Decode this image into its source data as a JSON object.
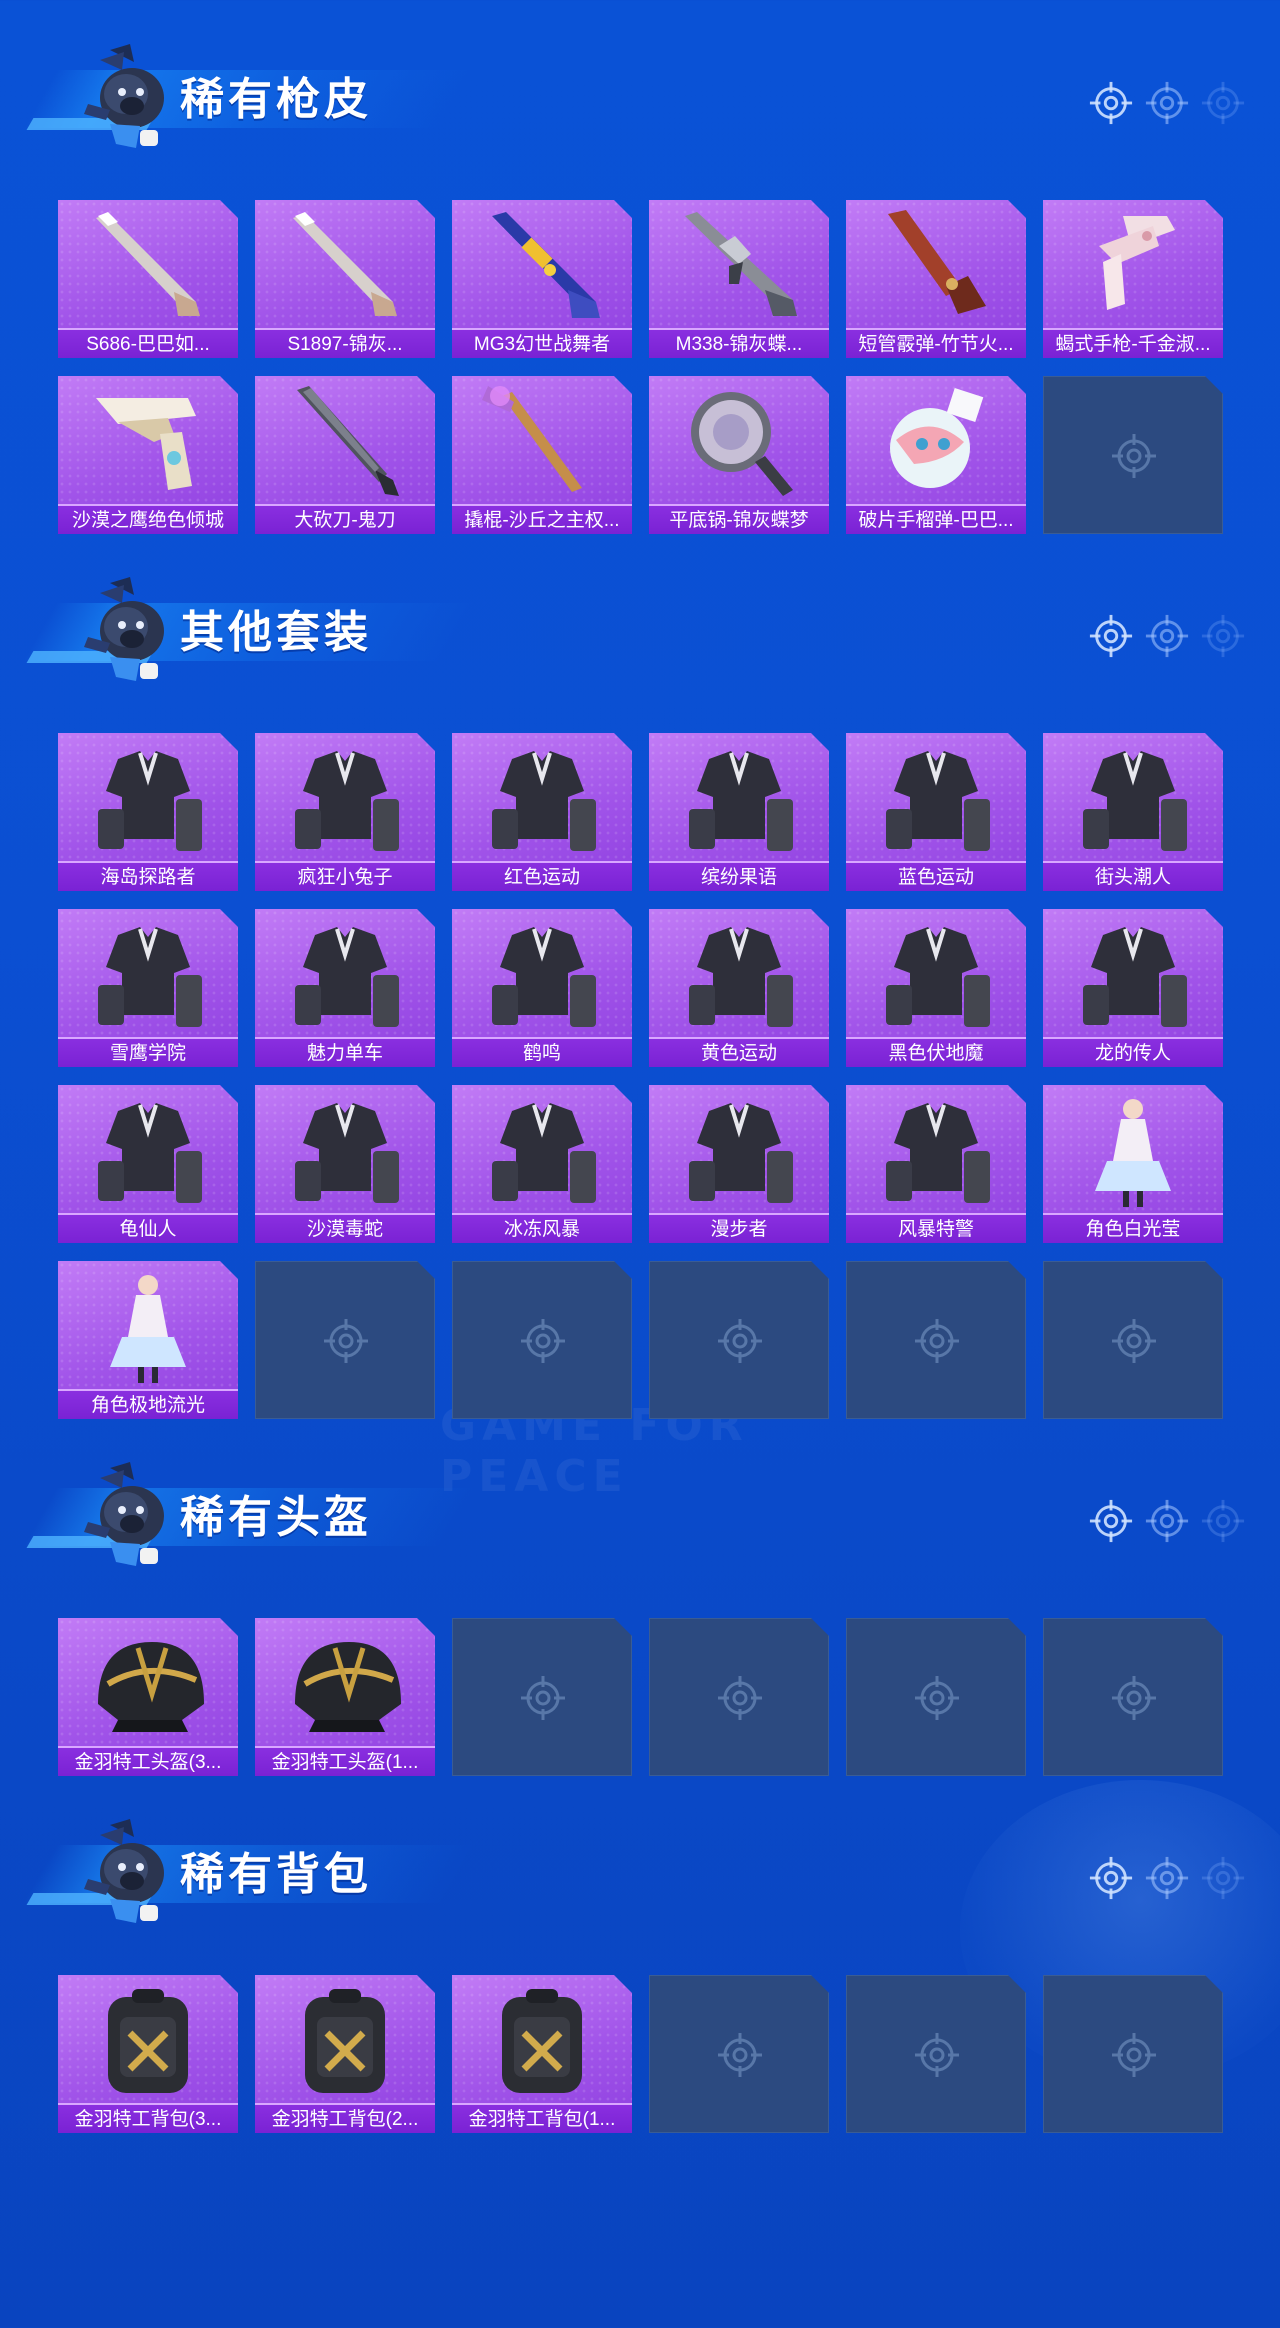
{
  "colors": {
    "background": "#0a52d6",
    "card_fill": "#a154e9",
    "card_label": "#7a22d4",
    "card_empty": "#2c4a80",
    "title_text": "#ffffff"
  },
  "watermark": "GAME FOR PEACE",
  "sections": [
    {
      "title": "稀有枪皮",
      "items": [
        {
          "label": "S686-巴巴如...",
          "icon": "shotgun-icon"
        },
        {
          "label": "S1897-锦灰...",
          "icon": "shotgun-icon"
        },
        {
          "label": "MG3幻世战舞者",
          "icon": "machine-gun-icon"
        },
        {
          "label": "M338-锦灰蝶...",
          "icon": "rifle-icon"
        },
        {
          "label": "短管霰弹-竹节火...",
          "icon": "flintlock-icon"
        },
        {
          "label": "蝎式手枪-千金淑...",
          "icon": "smg-icon"
        },
        {
          "label": "沙漠之鹰绝色倾城",
          "icon": "pistol-icon"
        },
        {
          "label": "大砍刀-鬼刀",
          "icon": "machete-icon"
        },
        {
          "label": "撬棍-沙丘之主权...",
          "icon": "crowbar-icon"
        },
        {
          "label": "平底锅-锦灰蝶梦",
          "icon": "pan-icon"
        },
        {
          "label": "破片手榴弹-巴巴...",
          "icon": "grenade-icon"
        }
      ],
      "empty_slots": 1
    },
    {
      "title": "其他套装",
      "items": [
        {
          "label": "海岛探路者",
          "icon": "outfit-icon"
        },
        {
          "label": "疯狂小兔子",
          "icon": "outfit-icon"
        },
        {
          "label": "红色运动",
          "icon": "outfit-icon"
        },
        {
          "label": "缤纷果语",
          "icon": "outfit-icon"
        },
        {
          "label": "蓝色运动",
          "icon": "outfit-icon"
        },
        {
          "label": "街头潮人",
          "icon": "outfit-icon"
        },
        {
          "label": "雪鹰学院",
          "icon": "outfit-icon"
        },
        {
          "label": "魅力单车",
          "icon": "outfit-icon"
        },
        {
          "label": "鹤鸣",
          "icon": "outfit-icon"
        },
        {
          "label": "黄色运动",
          "icon": "outfit-icon"
        },
        {
          "label": "黑色伏地魔",
          "icon": "outfit-icon"
        },
        {
          "label": "龙的传人",
          "icon": "outfit-icon"
        },
        {
          "label": "龟仙人",
          "icon": "outfit-icon"
        },
        {
          "label": "沙漠毒蛇",
          "icon": "outfit-icon"
        },
        {
          "label": "冰冻风暴",
          "icon": "outfit-icon"
        },
        {
          "label": "漫步者",
          "icon": "outfit-icon"
        },
        {
          "label": "风暴特警",
          "icon": "outfit-icon"
        },
        {
          "label": "角色白光莹",
          "icon": "character-icon"
        },
        {
          "label": "角色极地流光",
          "icon": "character-icon"
        }
      ],
      "empty_slots": 5
    },
    {
      "title": "稀有头盔",
      "items": [
        {
          "label": "金羽特工头盔(3...",
          "icon": "helmet-icon"
        },
        {
          "label": "金羽特工头盔(1...",
          "icon": "helmet-icon"
        }
      ],
      "empty_slots": 4
    },
    {
      "title": "稀有背包",
      "items": [
        {
          "label": "金羽特工背包(3...",
          "icon": "backpack-icon"
        },
        {
          "label": "金羽特工背包(2...",
          "icon": "backpack-icon"
        },
        {
          "label": "金羽特工背包(1...",
          "icon": "backpack-icon"
        }
      ],
      "empty_slots": 3
    }
  ]
}
